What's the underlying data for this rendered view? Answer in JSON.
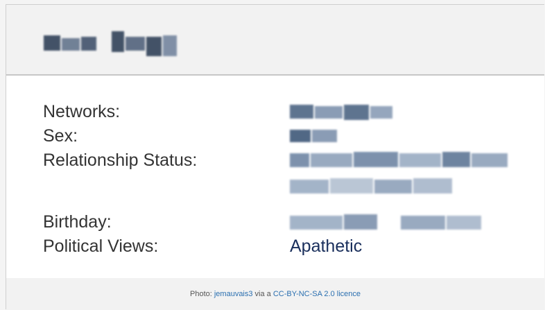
{
  "profile": {
    "rows": [
      {
        "label": "Networks:"
      },
      {
        "label": "Sex:"
      },
      {
        "label": "Relationship Status:"
      },
      {
        "label": "Birthday:"
      },
      {
        "label": "Political Views:",
        "value": "Apathetic"
      }
    ]
  },
  "credit": {
    "prefix": "Photo: ",
    "author": "jemauvais3",
    "middle": " via a ",
    "licence": "CC-BY-NC-SA 2.0 licence"
  },
  "colors": {
    "background": "#f2f2f2",
    "panel": "#ffffff",
    "label_text": "#333333",
    "value_text": "#1a2f5c",
    "link": "#2a6fb0",
    "pixelated_dark": "#3f5878",
    "pixelated_light": "#aab8cc"
  }
}
